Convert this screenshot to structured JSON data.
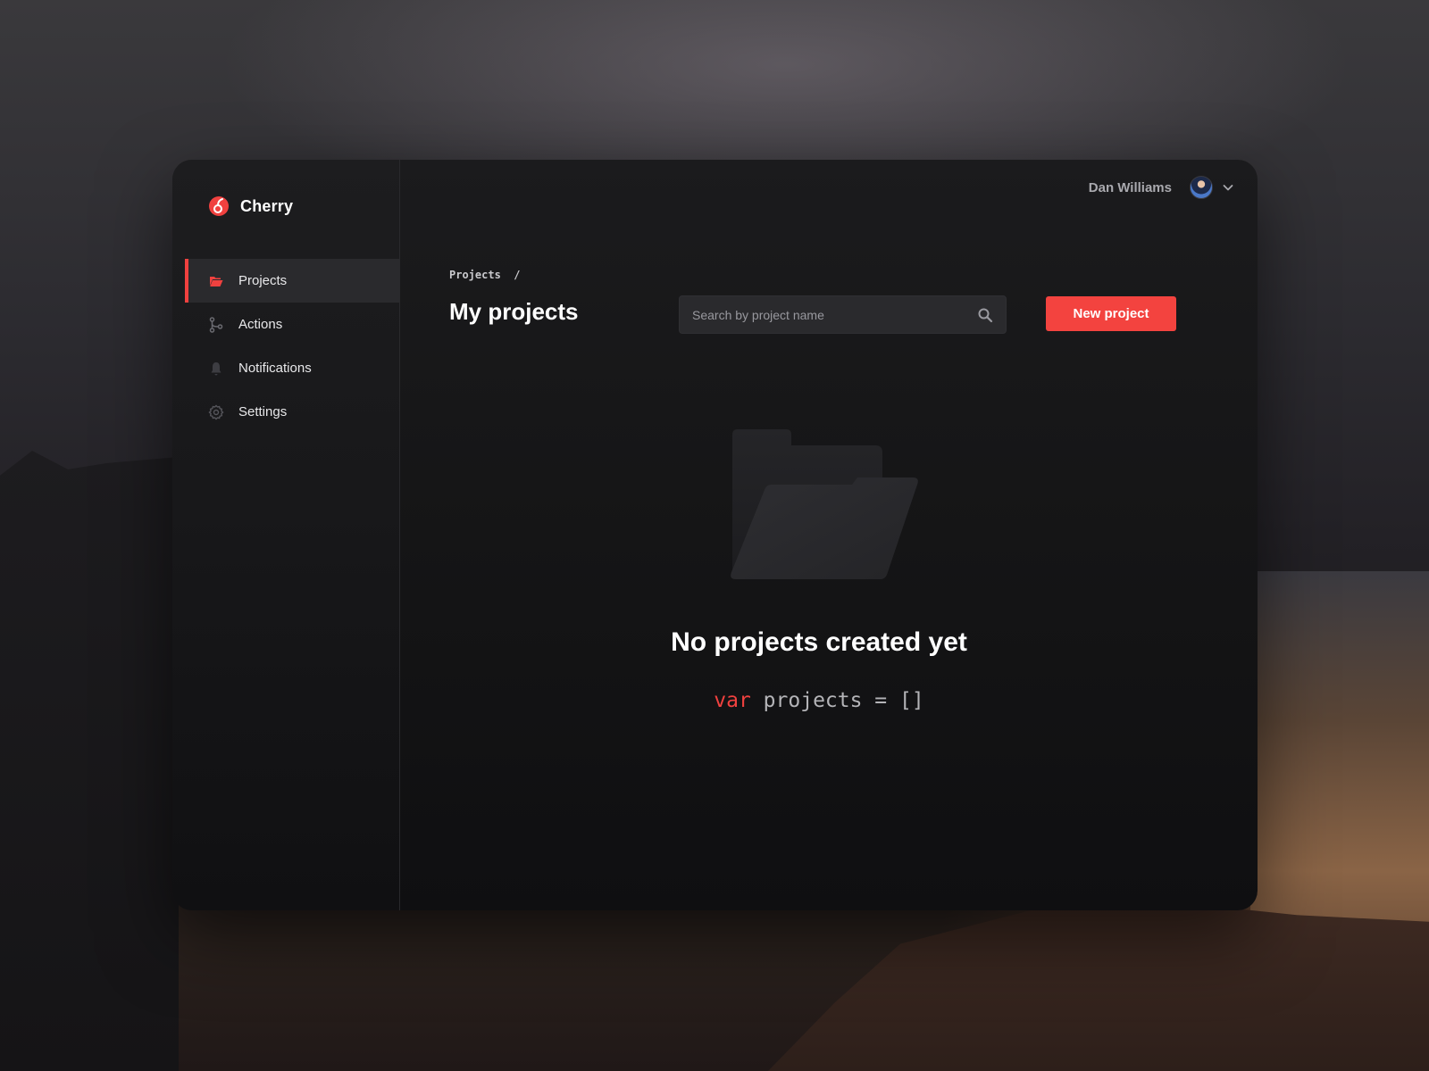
{
  "app": {
    "name": "Cherry",
    "accent_color": "#f3433f"
  },
  "sidebar": {
    "items": [
      {
        "label": "Projects",
        "icon": "folder-open-icon",
        "active": true
      },
      {
        "label": "Actions",
        "icon": "git-branch-icon",
        "active": false
      },
      {
        "label": "Notifications",
        "icon": "bell-icon",
        "active": false
      },
      {
        "label": "Settings",
        "icon": "gear-icon",
        "active": false
      }
    ]
  },
  "header": {
    "user_name": "Dan Williams"
  },
  "main": {
    "breadcrumb": "Projects  /",
    "title": "My projects",
    "search": {
      "placeholder": "Search by project name",
      "value": ""
    },
    "new_button_label": "New project",
    "empty_state": {
      "title": "No projects created yet",
      "code_keyword": "var",
      "code_rest": " projects = []"
    }
  }
}
